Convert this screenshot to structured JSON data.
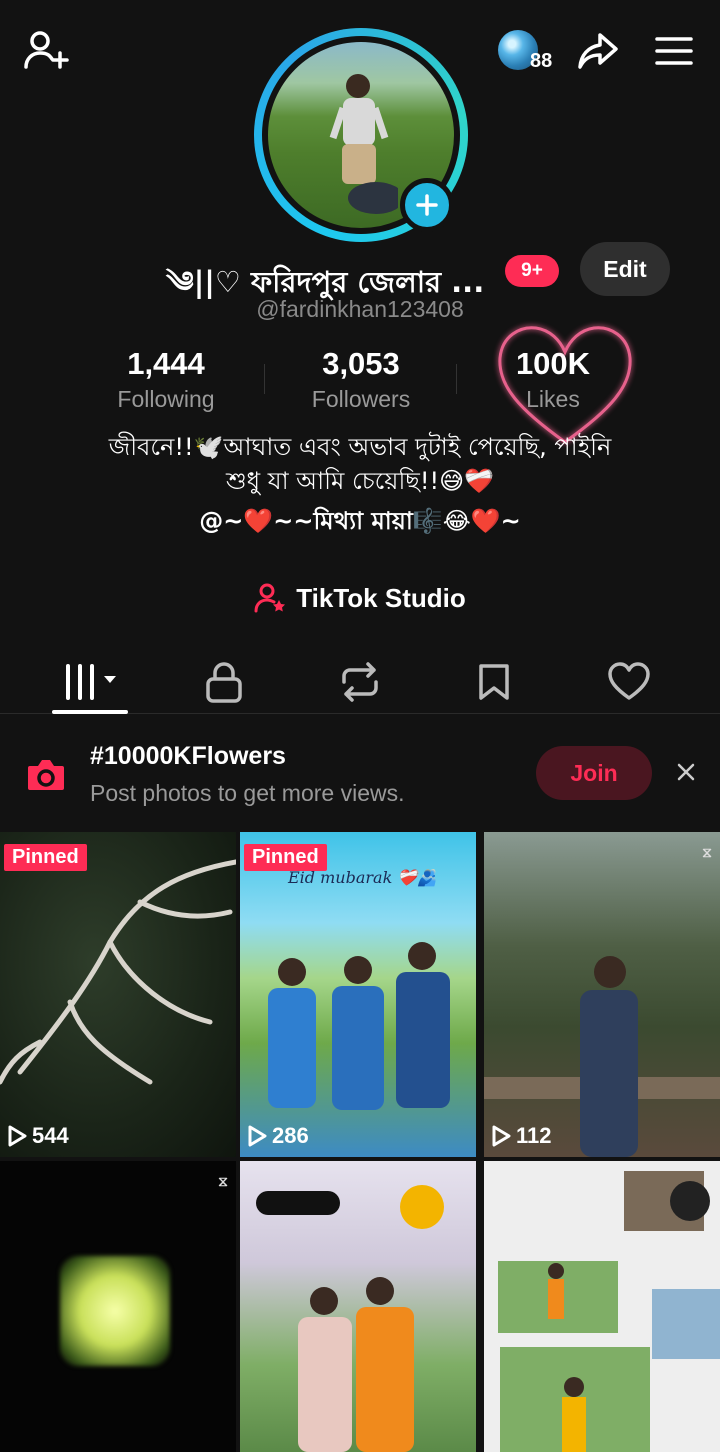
{
  "header": {
    "coin_count": "88"
  },
  "profile": {
    "display_name": "༄||♡ ফরিদপুর জেলার ...",
    "notification_badge": "9+",
    "edit_label": "Edit",
    "username": "@fardinkhan123408"
  },
  "stats": [
    {
      "value": "1,444",
      "label": "Following"
    },
    {
      "value": "3,053",
      "label": "Followers"
    },
    {
      "value": "100K",
      "label": "Likes"
    }
  ],
  "bio": {
    "line1": "জীবনে!!🕊️আঘাত এবং অভাব দুটাই পেয়েছি, পাইনি",
    "line2": "শুধু যা আমি চেয়েছি!!😅❤️‍🩹",
    "line3": "@~❤️~~মিথ্যা মায়া🎼😂❤️~"
  },
  "studio": {
    "label": "TikTok Studio"
  },
  "tabs": [
    {
      "name": "videos",
      "icon": "grid-lines-icon",
      "active": true
    },
    {
      "name": "private",
      "icon": "lock-icon"
    },
    {
      "name": "reposts",
      "icon": "repost-icon"
    },
    {
      "name": "favorites",
      "icon": "bookmark-icon"
    },
    {
      "name": "liked",
      "icon": "heart-icon"
    }
  ],
  "banner": {
    "hashtag": "#10000KFlowers",
    "subtitle": "Post photos to get more views.",
    "join_label": "Join"
  },
  "videos": [
    {
      "pinned": "Pinned",
      "views": "544"
    },
    {
      "pinned": "Pinned",
      "views": "286",
      "overlay": "Eid mubarak ❤️‍🩹🫂"
    },
    {
      "views": "112"
    },
    {},
    {},
    {}
  ],
  "colors": {
    "accent": "#fe2c55",
    "ring": "#1ec8f0",
    "background": "#121212"
  }
}
